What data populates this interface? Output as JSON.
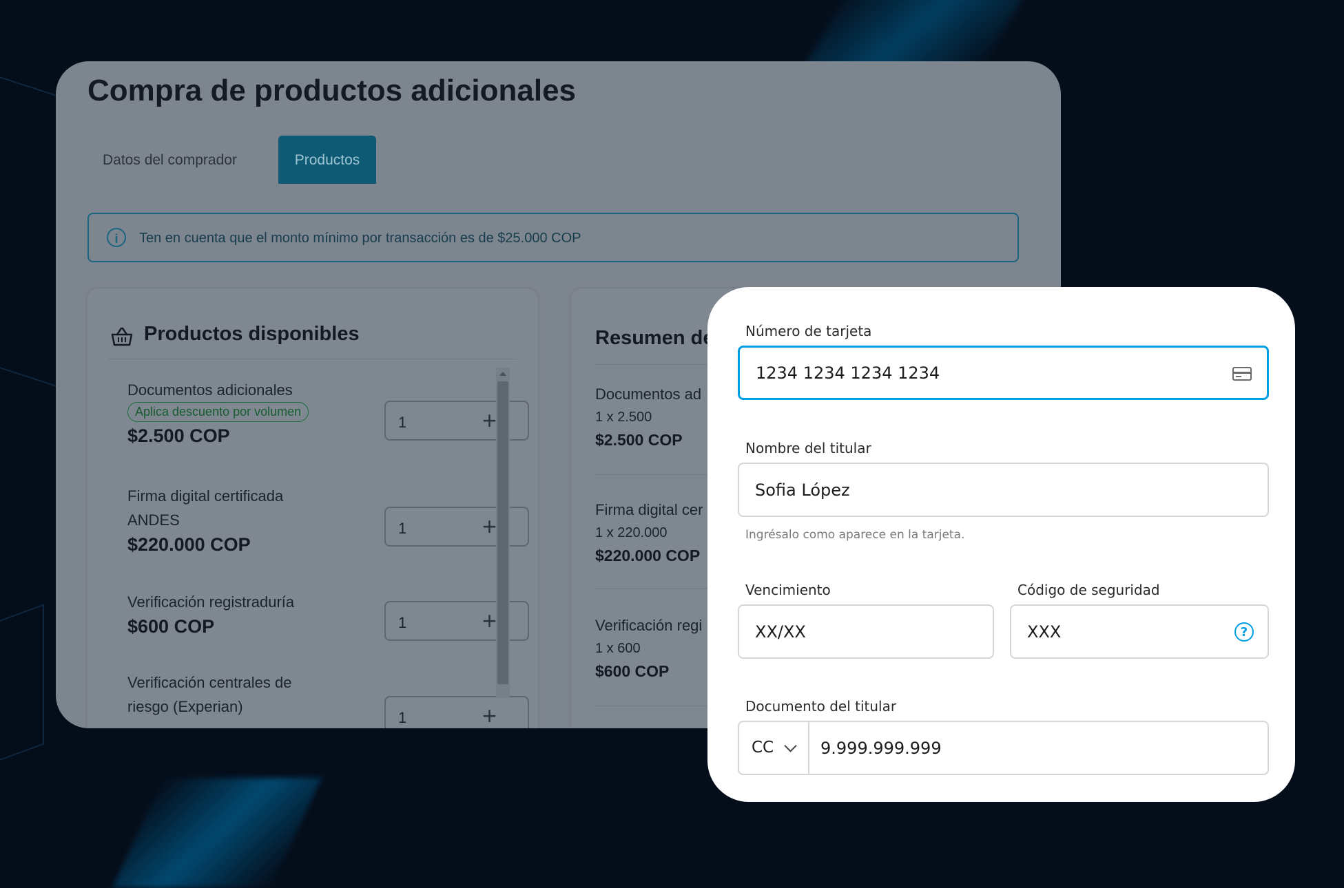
{
  "page": {
    "title": "Compra de productos adicionales",
    "tabs": [
      {
        "label": "Datos del comprador",
        "active": false
      },
      {
        "label": "Productos",
        "active": true
      }
    ],
    "info_banner": "Ten en cuenta que el monto mínimo por transacción es de $25.000 COP",
    "info_icon": "info-icon"
  },
  "products": {
    "heading": "Productos disponibles",
    "icon": "basket-icon",
    "items": [
      {
        "name": "Documentos adicionales",
        "badge": "Aplica descuento por volumen",
        "price": "$2.500 COP",
        "qty": "1"
      },
      {
        "name": "Firma digital certificada ANDES",
        "price": "$220.000 COP",
        "qty": "1"
      },
      {
        "name": "Verificación registraduría",
        "price": "$600 COP",
        "qty": "1"
      },
      {
        "name": "Verificación centrales de riesgo (Experian)",
        "qty": "1"
      }
    ]
  },
  "summary": {
    "heading": "Resumen de",
    "items": [
      {
        "name": "Documentos ad",
        "qty_line": "1 x 2.500",
        "price": "$2.500 COP"
      },
      {
        "name": "Firma digital cer",
        "qty_line": "1 x 220.000",
        "price": "$220.000 COP"
      },
      {
        "name": "Verificación regi",
        "qty_line": "1 x 600",
        "price": "$600 COP"
      }
    ]
  },
  "payment": {
    "card_number": {
      "label": "Número de tarjeta",
      "value": "1234 1234 1234 1234",
      "icon": "credit-card-icon"
    },
    "holder_name": {
      "label": "Nombre del titular",
      "value": "Sofia López",
      "hint": "Ingrésalo como aparece en la tarjeta."
    },
    "expiry": {
      "label": "Vencimiento",
      "value": "XX/XX"
    },
    "cvv": {
      "label": "Código de seguridad",
      "value": "XXX",
      "icon": "help-icon",
      "icon_glyph": "?"
    },
    "document": {
      "label": "Documento del titular",
      "type": "CC",
      "value": "9.999.999.999"
    }
  },
  "colors": {
    "accent": "#009ee3",
    "active_tab": "#0e5a74",
    "background": "#040d1a"
  }
}
